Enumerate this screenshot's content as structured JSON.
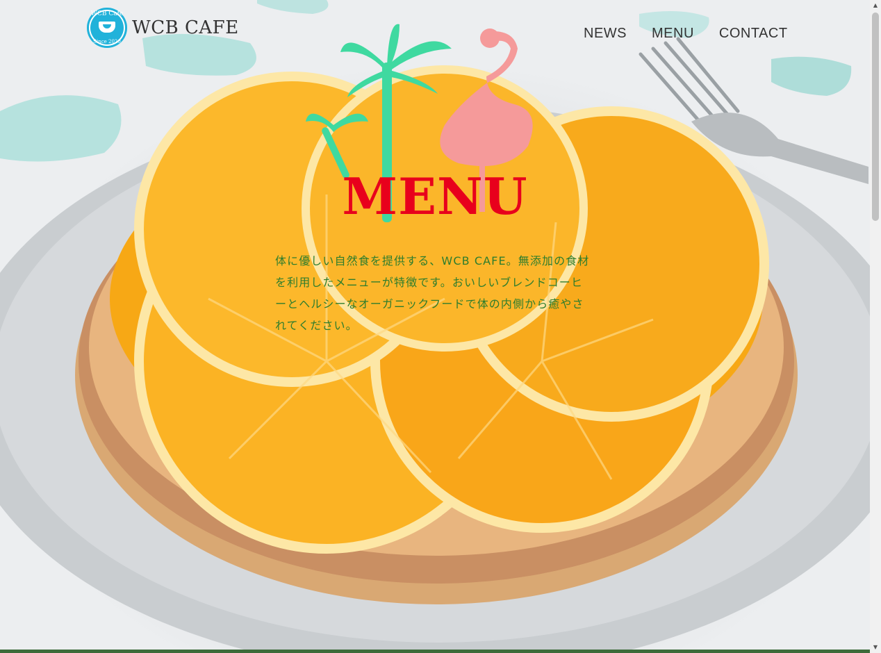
{
  "header": {
    "logo_text": "WCB CAFE",
    "logo_badge_top": "WCB Cafe",
    "logo_badge_bottom": "Since 2020",
    "nav": [
      "NEWS",
      "MENU",
      "CONTACT"
    ]
  },
  "hero": {
    "title": "MENU",
    "description": "体に優しい自然食を提供する、WCB CAFE。無添加の食材を利用したメニューが特徴です。おいしいブレンドコーヒーとヘルシーなオーガニックフードで体の内側から癒やされてください。"
  },
  "colors": {
    "title": "#e8001c",
    "description": "#2d7d2d",
    "logo_badge": "#21b2da"
  }
}
